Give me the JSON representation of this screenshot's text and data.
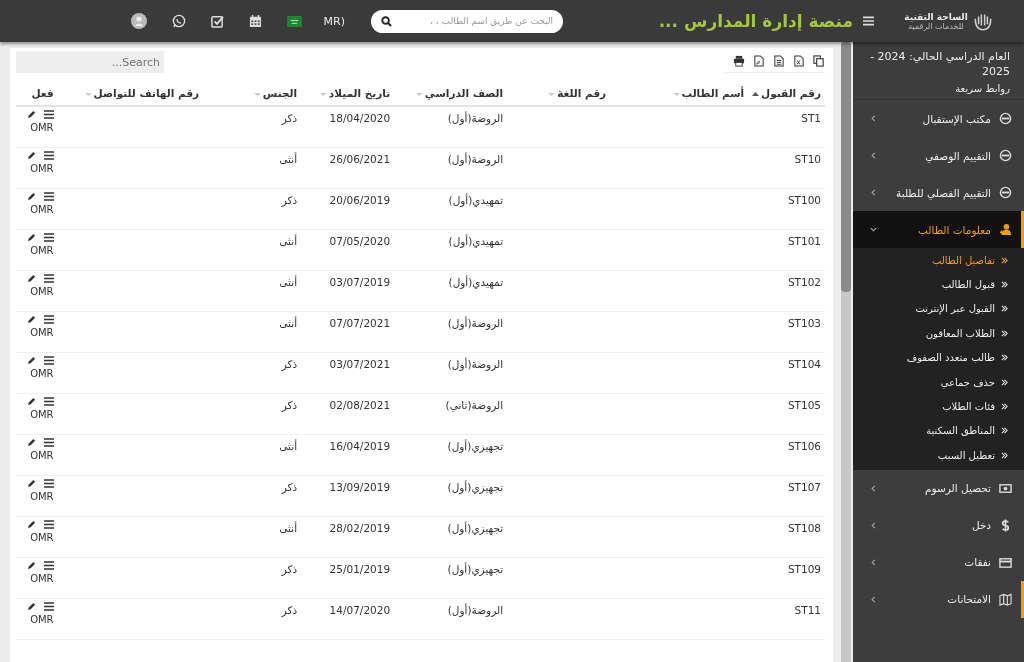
{
  "topbar": {
    "logo_text": "الساحة التقنية",
    "logo_subtext": "للخدمات الرقمية",
    "title": "منصة إدارة المدارس ...",
    "search": {
      "placeholder": "البحث عن طريق اسم الطالب ، ،"
    },
    "currency": "MR)"
  },
  "sidebar": {
    "academic_year": "العام الدراسي الحالي: 2024 - 2025",
    "quick_links": "روابط سريعة",
    "items": [
      {
        "label": "مكتب الإستقبال",
        "expanded": false,
        "selected": false,
        "hovered": false
      },
      {
        "label": "التقييم الوصفي",
        "expanded": false,
        "selected": false,
        "hovered": false
      },
      {
        "label": "التقييم الفصلي للطلبة",
        "expanded": false,
        "selected": false,
        "hovered": false
      },
      {
        "label": "معلومات الطالب",
        "expanded": true,
        "selected": true,
        "hovered": false,
        "children": [
          {
            "label": "تفاصيل الطالب",
            "selected": true
          },
          {
            "label": "قبول الطالب",
            "selected": false
          },
          {
            "label": "القبول عبر الإنترنت",
            "selected": false
          },
          {
            "label": "الطلاب المعاقون",
            "selected": false
          },
          {
            "label": "طالب متعدد الصفوف",
            "selected": false
          },
          {
            "label": "حذف جماعي",
            "selected": false
          },
          {
            "label": "فئات الطلاب",
            "selected": false
          },
          {
            "label": "المناطق السكنية",
            "selected": false
          },
          {
            "label": "تعطيل السبب",
            "selected": false
          }
        ]
      },
      {
        "label": "تحصيل الرسوم",
        "expanded": false,
        "selected": false,
        "hovered": false
      },
      {
        "label": "دخل",
        "expanded": false,
        "selected": false,
        "hovered": false
      },
      {
        "label": "نفقات",
        "expanded": false,
        "selected": false,
        "hovered": false
      },
      {
        "label": "الامتحانات",
        "expanded": false,
        "selected": false,
        "hovered": true
      }
    ]
  },
  "table": {
    "search": {
      "placeholder": "Search..."
    },
    "columns": [
      {
        "label": "رقم القبول",
        "sorted": true
      },
      {
        "label": "أسم الطالب",
        "sorted": false
      },
      {
        "label": "رقم اللغة",
        "sorted": false
      },
      {
        "label": "الصف الدراسي",
        "sorted": false
      },
      {
        "label": "تاريخ الميلاد",
        "sorted": false
      },
      {
        "label": "الجنس",
        "sorted": false
      },
      {
        "label": "رقم الهاتف للتواصل",
        "sorted": false
      },
      {
        "label": "فعل"
      }
    ],
    "rows": [
      {
        "id": "ST1",
        "grade": "الروضة(أول)",
        "birth": "18/04/2020",
        "gender": "ذكر",
        "action": "OMR"
      },
      {
        "id": "ST10",
        "grade": "الروضة(أول)",
        "birth": "26/06/2021",
        "gender": "أنثى",
        "action": "OMR"
      },
      {
        "id": "ST100",
        "grade": "تمهيدي(أول)",
        "birth": "20/06/2019",
        "gender": "ذكر",
        "action": "OMR"
      },
      {
        "id": "ST101",
        "grade": "تمهيدي(أول)",
        "birth": "07/05/2020",
        "gender": "أنثى",
        "action": "OMR"
      },
      {
        "id": "ST102",
        "grade": "تمهيدي(أول)",
        "birth": "03/07/2019",
        "gender": "أنثى",
        "action": "OMR"
      },
      {
        "id": "ST103",
        "grade": "الروضة(أول)",
        "birth": "07/07/2021",
        "gender": "أنثى",
        "action": "OMR"
      },
      {
        "id": "ST104",
        "grade": "الروضة(أول)",
        "birth": "03/07/2021",
        "gender": "ذكر",
        "action": "OMR"
      },
      {
        "id": "ST105",
        "grade": "الروضة(ثاني)",
        "birth": "02/08/2021",
        "gender": "ذكر",
        "action": "OMR"
      },
      {
        "id": "ST106",
        "grade": "تجهيزي(أول)",
        "birth": "16/04/2019",
        "gender": "أنثى",
        "action": "OMR"
      },
      {
        "id": "ST107",
        "grade": "تجهيزي(أول)",
        "birth": "13/09/2019",
        "gender": "ذكر",
        "action": "OMR"
      },
      {
        "id": "ST108",
        "grade": "تجهيزي(أول)",
        "birth": "28/02/2019",
        "gender": "أنثى",
        "action": "OMR"
      },
      {
        "id": "ST109",
        "grade": "تجهيزي(أول)",
        "birth": "25/01/2019",
        "gender": "ذكر",
        "action": "OMR"
      },
      {
        "id": "ST11",
        "grade": "الروضة(أول)",
        "birth": "14/07/2020",
        "gender": "ذكر",
        "action": "OMR"
      }
    ]
  }
}
